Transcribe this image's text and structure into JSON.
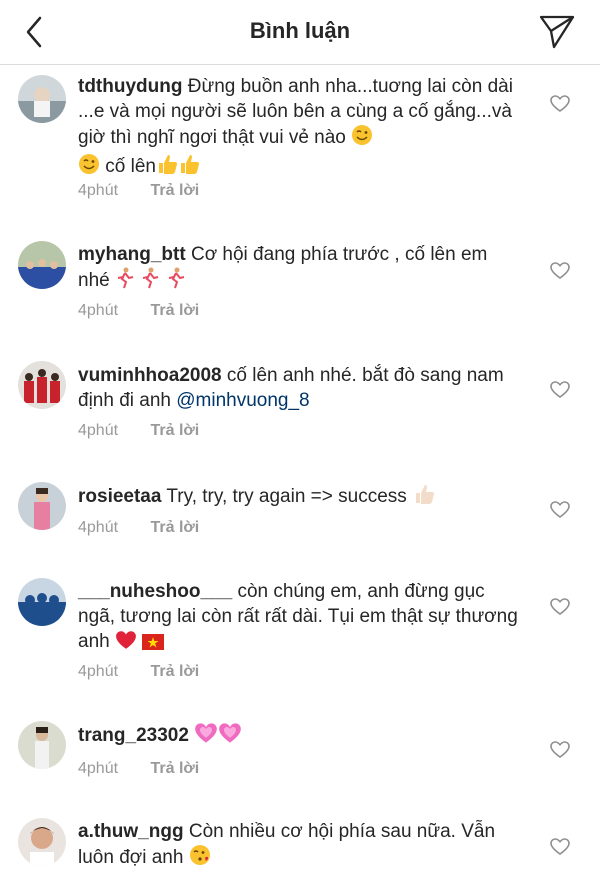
{
  "header": {
    "title": "Bình luận",
    "back_icon": "chevron-left-icon",
    "send_icon": "paper-plane-icon"
  },
  "comments": [
    {
      "user": "tdthuydung",
      "text": "Đừng buồn anh nha...tuơng lai còn dài ...e và mọi người sẽ luôn bên a cùng a cố gắng...và giờ thì nghĩ ngơi thật vui vẻ nào",
      "text2": "cố lên",
      "time": "4phút",
      "reply": "Trả lời"
    },
    {
      "user": "myhang_btt",
      "text": "Cơ hội đang phía trước , cố lên em nhé",
      "time": "4phút",
      "reply": "Trả lời"
    },
    {
      "user": "vuminhhoa2008",
      "text": "cố lên anh nhé. bắt đò sang nam định đi anh",
      "mention": "@minhvuong_8",
      "time": "4phút",
      "reply": "Trả lời"
    },
    {
      "user": "rosieetaa",
      "text": "Try, try, try again => success",
      "time": "4phút",
      "reply": "Trả lời"
    },
    {
      "user": "___nuheshoo___",
      "text": "còn chúng em, anh đừng gục ngã, tương lai còn rất rất dài. Tụi em thật sự thương anh",
      "time": "4phút",
      "reply": "Trả lời"
    },
    {
      "user": "trang_23302",
      "text": "",
      "time": "4phút",
      "reply": "Trả lời"
    },
    {
      "user": "a.thuw_ngg",
      "text": "Còn nhiều cơ hội phía sau nữa. Vẫn luôn đợi anh",
      "time": "",
      "reply": ""
    }
  ],
  "colors": {
    "text": "#262626",
    "meta": "#999999",
    "mention": "#003569",
    "divider": "#dbdbdb"
  }
}
